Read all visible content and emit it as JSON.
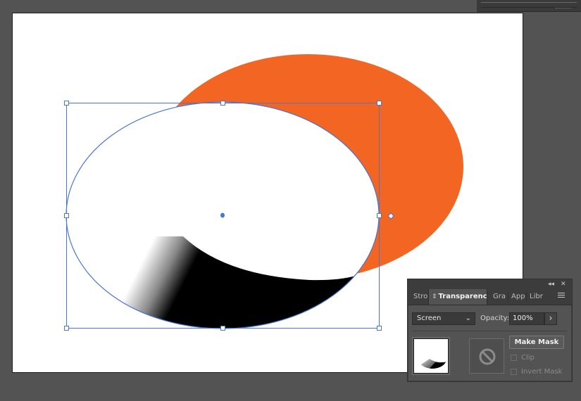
{
  "canvas": {
    "background_color": "#535353",
    "artboard_color": "#ffffff",
    "orange_color": "#f26522",
    "selection_color": "#4a76d4"
  },
  "panel": {
    "collapse_icon": "double-chevron-left-icon",
    "close_icon": "close-icon",
    "tabs": [
      {
        "label": "Stro",
        "active": false
      },
      {
        "label": "Transparency",
        "active": true
      },
      {
        "label": "Gra",
        "active": false
      },
      {
        "label": "App",
        "active": false
      },
      {
        "label": "Libr",
        "active": false
      }
    ],
    "menu_icon": "hamburger-menu-icon",
    "blend_mode": "Screen",
    "opacity_label": "Opacity:",
    "opacity_value": "100%",
    "make_mask_label": "Make Mask",
    "clip_label": "Clip",
    "invert_mask_label": "Invert Mask",
    "clip_checked": false,
    "invert_mask_checked": false,
    "no_mask_icon": "prohibited-icon"
  }
}
